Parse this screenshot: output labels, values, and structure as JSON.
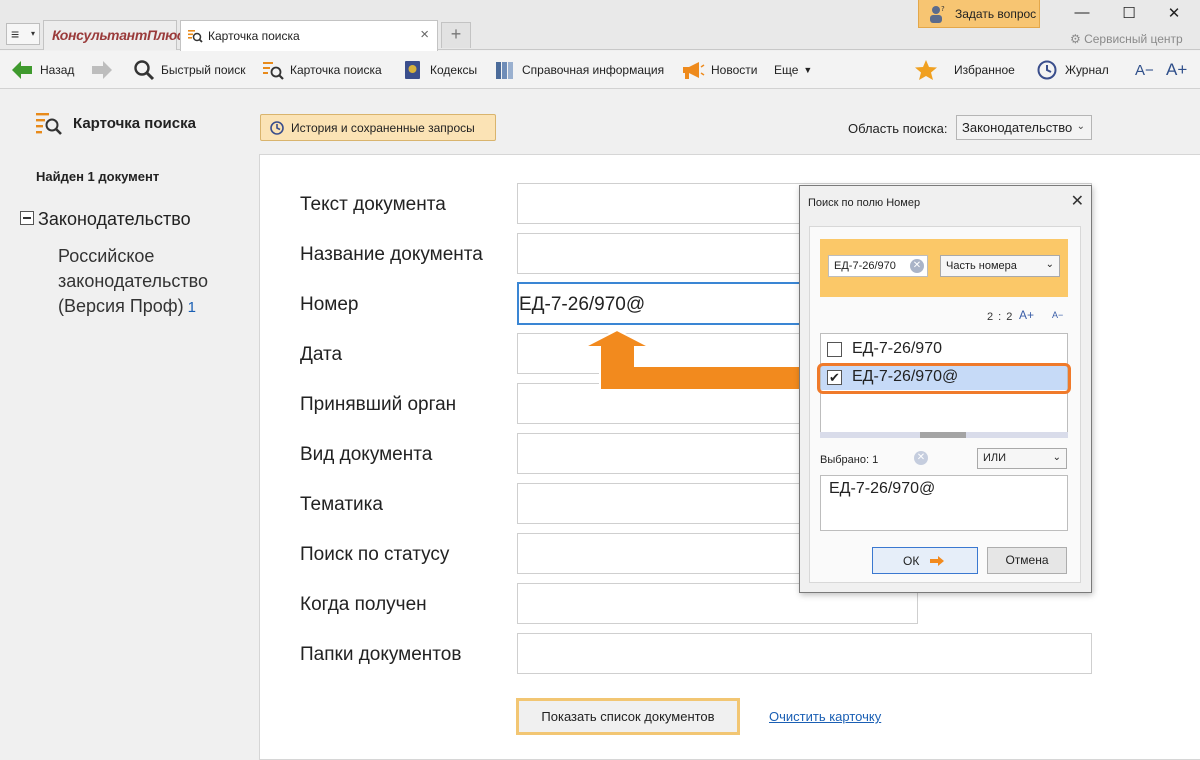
{
  "titlebar": {
    "brand": "КонсультантПлюс",
    "tab_title": "Карточка поиска",
    "ask_button": "Задать вопрос",
    "service_center": "Сервисный центр"
  },
  "toolbar": {
    "back": "Назад",
    "quick_search": "Быстрый поиск",
    "search_card": "Карточка поиска",
    "codes": "Кодексы",
    "reference": "Справочная информация",
    "news": "Новости",
    "more": "Еще",
    "favorites": "Избранное",
    "journal": "Журнал",
    "font_decrease": "A−",
    "font_increase": "A+"
  },
  "left": {
    "title": "Карточка поиска",
    "found": "Найден 1 документ",
    "tree_root": "Законодательство",
    "tree_child": "Российское законодательство (Версия Проф)",
    "tree_child_count": "1"
  },
  "main": {
    "history_button": "История и сохраненные запросы",
    "scope_label": "Область поиска:",
    "scope_value": "Законодательство",
    "fields": [
      {
        "label": "Текст документа",
        "value": ""
      },
      {
        "label": "Название документа",
        "value": ""
      },
      {
        "label": "Номер",
        "value": "ЕД-7-26/970@"
      },
      {
        "label": "Дата",
        "value": ""
      },
      {
        "label": "Принявший орган",
        "value": ""
      },
      {
        "label": "Вид документа",
        "value": ""
      },
      {
        "label": "Тематика",
        "value": ""
      },
      {
        "label": "Поиск по статусу",
        "value": ""
      },
      {
        "label": "Когда получен",
        "value": ""
      },
      {
        "label": "Папки документов",
        "value": ""
      }
    ],
    "show_button": "Показать список документов",
    "clear_link": "Очистить карточку"
  },
  "dialog": {
    "title": "Поиск по полю Номер",
    "search_value": "ЕД-7-26/970",
    "mode": "Часть номера",
    "ratio": "2 : 2",
    "font_increase": "A+",
    "font_decrease": "A−",
    "items": [
      {
        "text": "ЕД-7-26/970",
        "checked": false
      },
      {
        "text": "ЕД-7-26/970@",
        "checked": true
      }
    ],
    "selected_label": "Выбрано: 1",
    "operator": "ИЛИ",
    "selected_value": "ЕД-7-26/970@",
    "ok": "ОК",
    "cancel": "Отмена"
  },
  "colors": {
    "accent_orange": "#f28a1e",
    "highlight_orange": "#fbc868",
    "selection_blue": "#c6daf7",
    "link_blue": "#1a5fb4"
  }
}
